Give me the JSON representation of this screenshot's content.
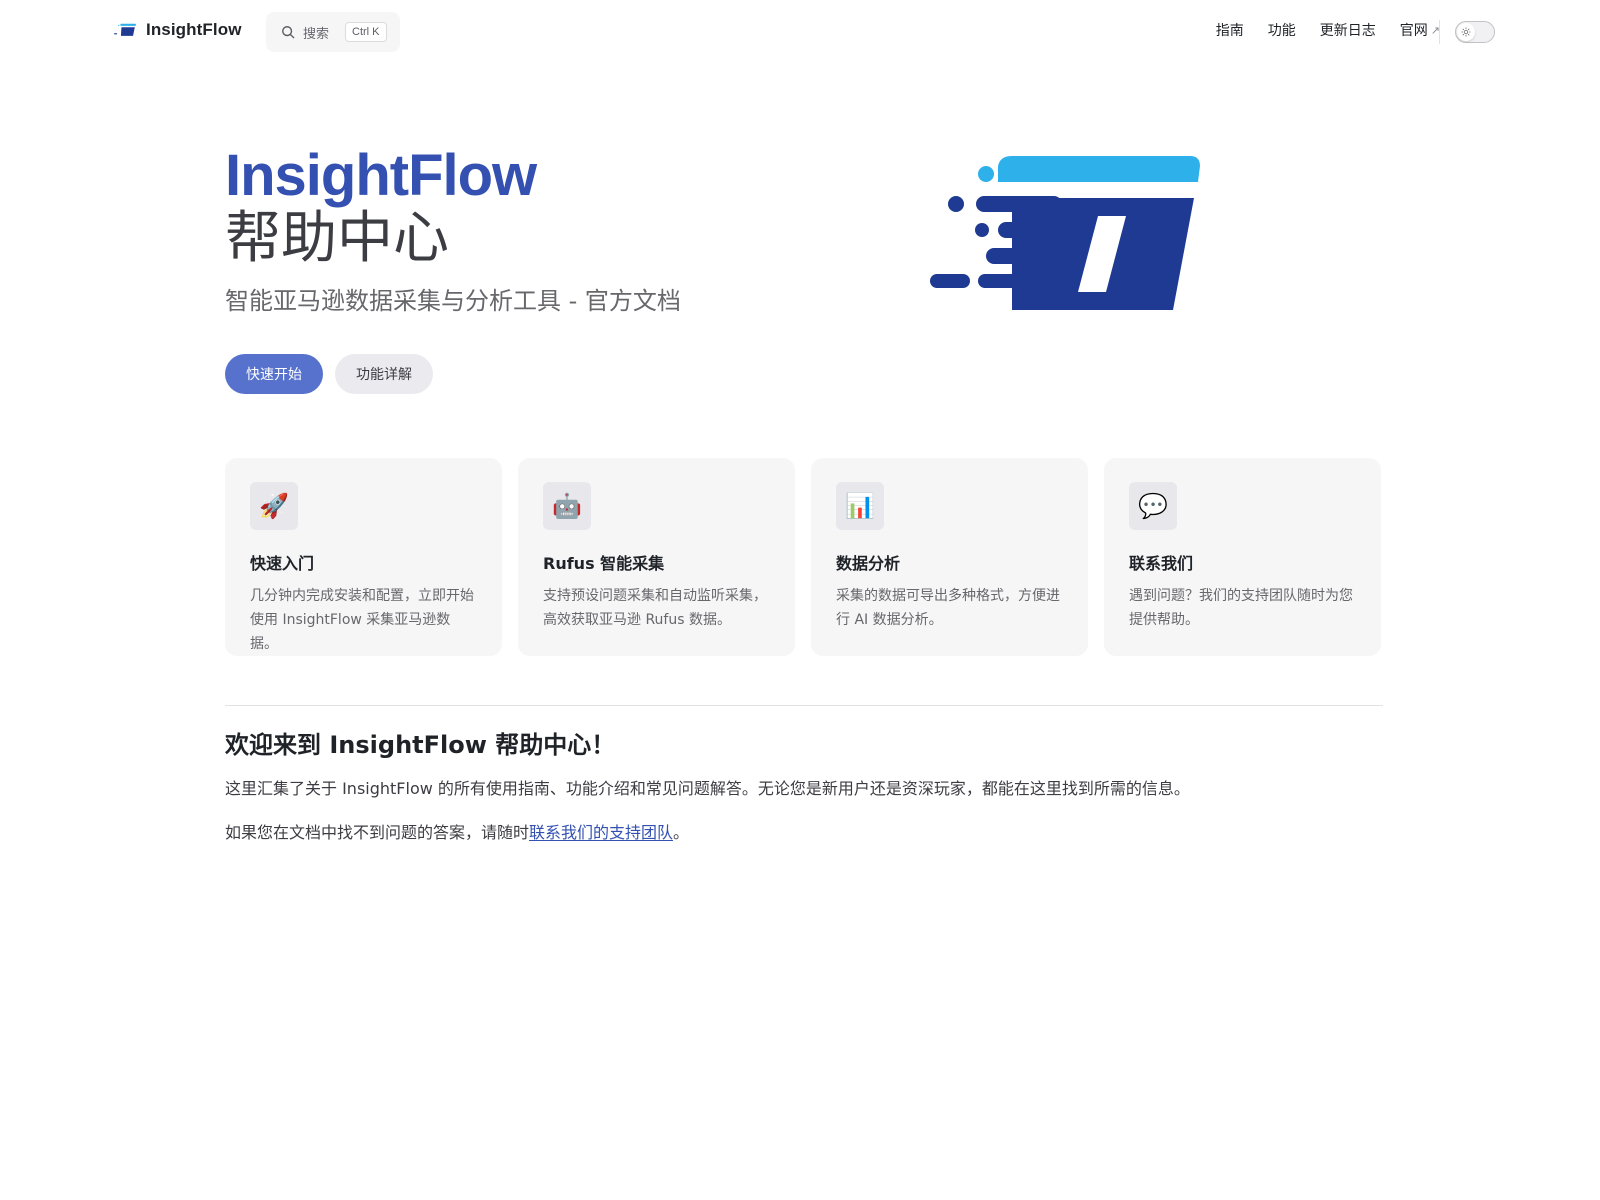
{
  "brand": {
    "name": "InsightFlow"
  },
  "search": {
    "placeholder": "搜索",
    "shortcut": "Ctrl K"
  },
  "nav": {
    "items": [
      {
        "label": "指南"
      },
      {
        "label": "功能"
      },
      {
        "label": "更新日志"
      },
      {
        "label": "官网",
        "external_icon": "↗"
      }
    ]
  },
  "theme_toggle": {
    "icon": "sun-icon",
    "mode": "light"
  },
  "hero": {
    "name": "InsightFlow",
    "text": "帮助中心",
    "tagline": "智能亚马逊数据采集与分析工具 - 官方文档",
    "actions": {
      "primary": "快速开始",
      "secondary": "功能详解"
    }
  },
  "features": [
    {
      "icon": "rocket-icon",
      "glyph": "🚀",
      "title": "快速入门",
      "details": "几分钟内完成安装和配置，立即开始使用 InsightFlow 采集亚马逊数据。"
    },
    {
      "icon": "robot-icon",
      "glyph": "🤖",
      "title": "Rufus 智能采集",
      "details": "支持预设问题采集和自动监听采集，高效获取亚马逊 Rufus 数据。"
    },
    {
      "icon": "bar-chart-icon",
      "glyph": "📊",
      "title": "数据分析",
      "details": "采集的数据可导出多种格式，方便进行 AI 数据分析。"
    },
    {
      "icon": "speech-bubble-icon",
      "glyph": "💬",
      "title": "联系我们",
      "details": "遇到问题？我们的支持团队随时为您提供帮助。"
    }
  ],
  "content": {
    "heading_pre": "欢迎来到 ",
    "heading_brand": "InsightFlow",
    "heading_post": " 帮助中心！",
    "para1": "这里汇集了关于 InsightFlow 的所有使用指南、功能介绍和常见问题解答。无论您是新用户还是资深玩家，都能在这里找到所需的信息。",
    "para2_pre": "如果您在文档中找不到问题的答案，请随时",
    "para2_link": "联系我们的支持团队",
    "para2_post": "。"
  },
  "colors": {
    "brand": "#3451b2",
    "brand_button": "#5672cd",
    "logo_light": "#2eb1ea",
    "logo_dark": "#1f3a93"
  }
}
